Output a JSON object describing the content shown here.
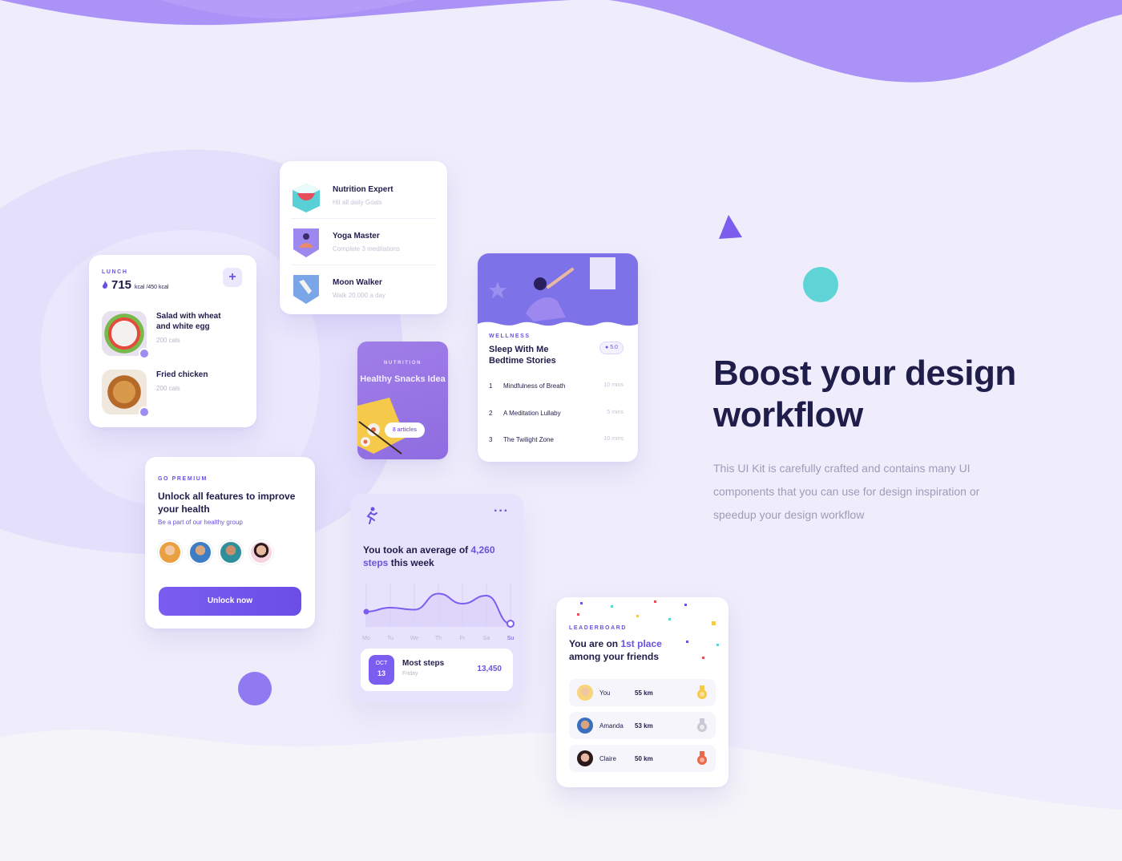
{
  "colors": {
    "accent": "#6a52e0",
    "background": "#efedfb",
    "dark": "#1f1d4a"
  },
  "lunch": {
    "eyebrow": "LUNCH",
    "calories": "715",
    "calories_unit": "kcal /450 kcal",
    "add_icon": "plus-icon",
    "items": [
      {
        "name": "Salad with wheat and white egg",
        "cals": "200 cals"
      },
      {
        "name": "Fried chicken",
        "cals": "200 cals"
      }
    ]
  },
  "achievements": [
    {
      "title": "Nutrition Expert",
      "sub": "Hit all daily Goals",
      "icon": "watermelon-icon"
    },
    {
      "title": "Yoga Master",
      "sub": "Complete 3 meditations",
      "icon": "yoga-icon"
    },
    {
      "title": "Moon Walker",
      "sub": "Walk 20.000 a day",
      "icon": "shoe-icon"
    }
  ],
  "nutrition": {
    "eyebrow": "NUTRITION",
    "title": "Healthy Snacks Idea",
    "button": "8 articles"
  },
  "wellness": {
    "eyebrow": "WELLNESS",
    "title": "Sleep With Me Bedtime Stories",
    "rating": "5.0",
    "tracks": [
      {
        "num": "1",
        "name": "Mindfulness of Breath",
        "duration": "10 mins"
      },
      {
        "num": "2",
        "name": "A Meditation Lullaby",
        "duration": "5 mins"
      },
      {
        "num": "3",
        "name": "The Twilight Zone",
        "duration": "10 mins"
      }
    ]
  },
  "premium": {
    "eyebrow": "GO PREMIUM",
    "title": "Unlock all features to improve your health",
    "sub": "Be a part of our healthy group",
    "button": "Unlock now"
  },
  "steps": {
    "title_prefix": "You took an average of ",
    "title_highlight": "4,260 steps",
    "title_suffix": " this week",
    "days": [
      "Mo",
      "Tu",
      "We",
      "Th",
      "Fr",
      "Sa",
      "Su"
    ],
    "chart_values": [
      0.3,
      0.4,
      0.35,
      0.75,
      0.5,
      0.7,
      0.0
    ],
    "date_month": "OCT",
    "date_day": "13",
    "most_title": "Most steps",
    "most_day": "Friday",
    "most_value": "13,450"
  },
  "leaderboard": {
    "eyebrow": "LEADERBOARD",
    "title_prefix": "You are on ",
    "title_highlight": "1st place",
    "title_suffix": " among your friends",
    "rows": [
      {
        "name": "You",
        "km": "55 km",
        "medal": "gold"
      },
      {
        "name": "Amanda",
        "km": "53 km",
        "medal": "silver"
      },
      {
        "name": "Claire",
        "km": "50 km",
        "medal": "bronze"
      }
    ]
  },
  "hero": {
    "title": "Boost your design workflow",
    "description": "This UI Kit is carefully crafted and contains many UI components that you can use for design inspiration or speedup your design workflow"
  }
}
